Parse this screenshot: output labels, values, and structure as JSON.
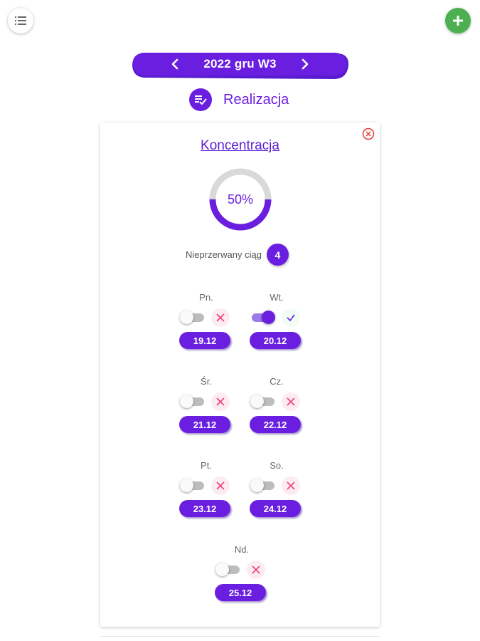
{
  "header": {
    "menu_icon": "list-icon",
    "add_icon": "plus-icon",
    "accent_color": "#6a1fe0",
    "add_color": "#4caf50"
  },
  "week_nav": {
    "label": "2022 gru W3",
    "prev_icon": "chevron-left-icon",
    "next_icon": "chevron-right-icon"
  },
  "section": {
    "icon": "checklist-icon",
    "title": "Realizacja"
  },
  "habit": {
    "title": "Koncentracja",
    "close_icon": "close-circle-icon",
    "progress": 0.5,
    "progress_label": "50%",
    "streak_label": "Nieprzerwany ciąg",
    "streak_value": "4",
    "days": [
      {
        "name": "Pn.",
        "date": "19.12",
        "done": false
      },
      {
        "name": "Wt.",
        "date": "20.12",
        "done": true
      },
      {
        "name": "Śr.",
        "date": "21.12",
        "done": false
      },
      {
        "name": "Cz.",
        "date": "22.12",
        "done": false
      },
      {
        "name": "Pt.",
        "date": "23.12",
        "done": false
      },
      {
        "name": "So.",
        "date": "24.12",
        "done": false
      },
      {
        "name": "Nd.",
        "date": "25.12",
        "done": false
      }
    ]
  }
}
